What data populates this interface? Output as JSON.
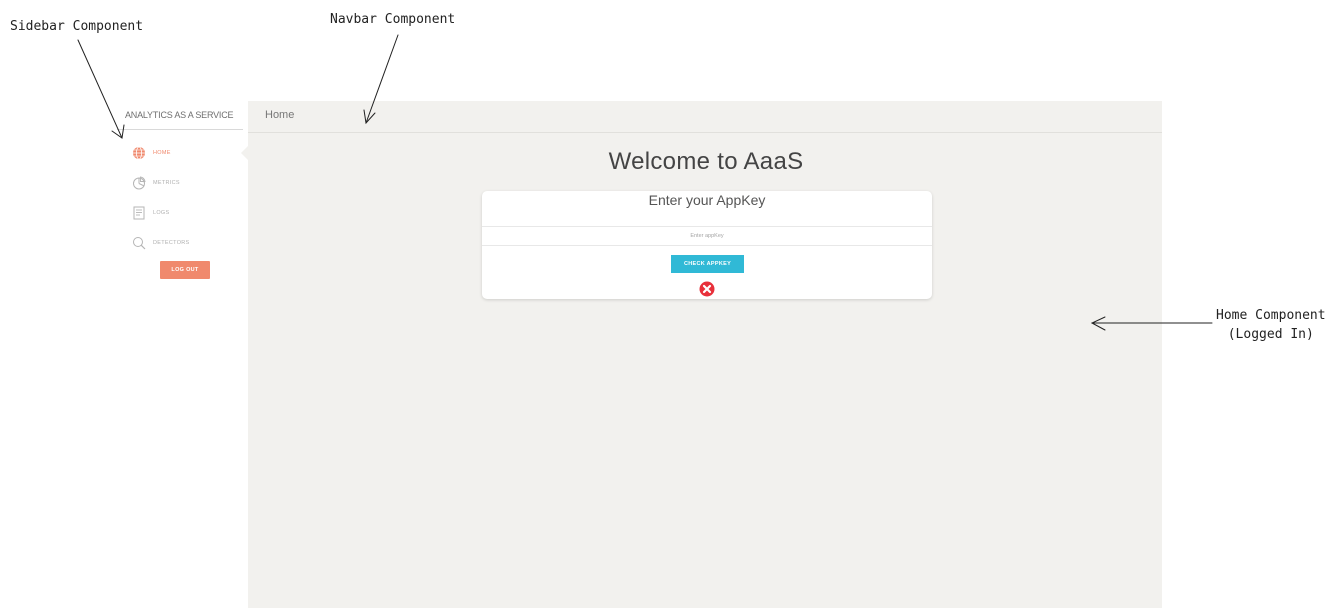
{
  "annotations": {
    "sidebar": "Sidebar Component",
    "navbar": "Navbar Component",
    "home_line1": "Home Component",
    "home_line2": "(Logged In)"
  },
  "sidebar": {
    "brand": "ANALYTICS AS A SERVICE",
    "items": [
      {
        "label": "HOME",
        "icon": "globe-icon",
        "active": true
      },
      {
        "label": "METRICS",
        "icon": "pie-chart-icon",
        "active": false
      },
      {
        "label": "LOGS",
        "icon": "document-icon",
        "active": false
      },
      {
        "label": "DETECTORS",
        "icon": "search-icon",
        "active": false
      }
    ],
    "logout_label": "LOG OUT"
  },
  "navbar": {
    "title": "Home"
  },
  "main": {
    "welcome": "Welcome to AaaS",
    "card": {
      "title": "Enter your AppKey",
      "input_placeholder": "Enter appKey",
      "input_value": "",
      "button_label": "CHECK APPKEY",
      "status_icon": "error-icon"
    }
  },
  "colors": {
    "accent": "#f0896d",
    "button": "#30b9d6",
    "error": "#e8303a",
    "panel_bg": "#f2f1ee"
  }
}
